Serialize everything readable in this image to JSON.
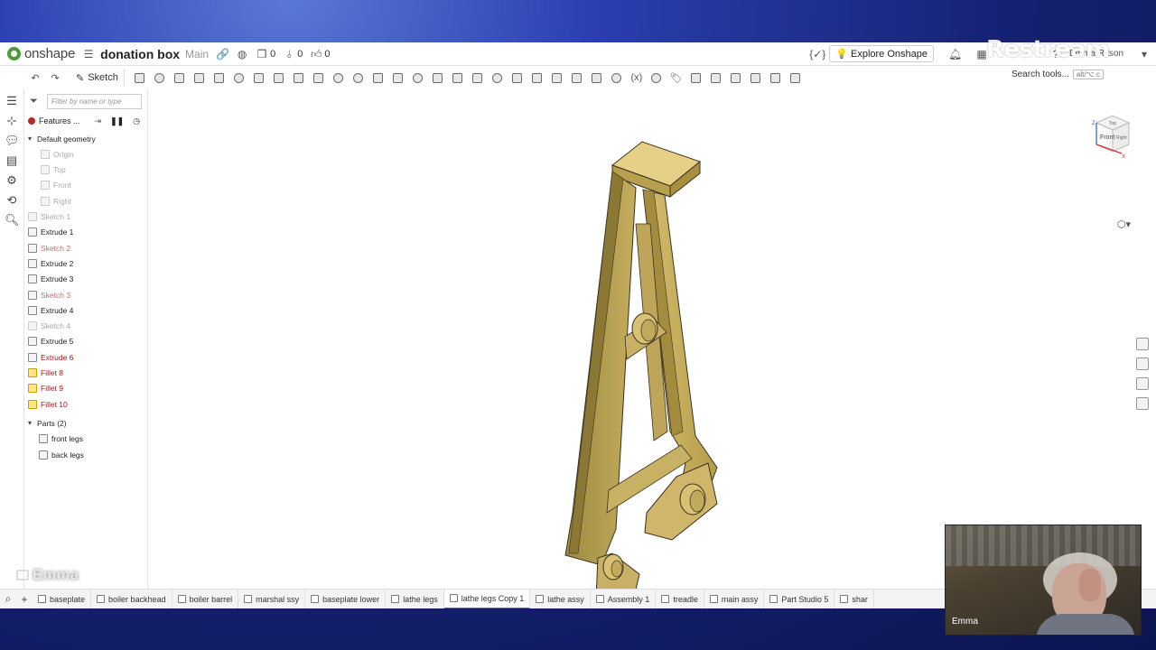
{
  "app": {
    "logo": "onshape",
    "doc_title": "donation box",
    "branch": "Main"
  },
  "topbar": {
    "counts": [
      "0",
      "0",
      "0"
    ],
    "explore_label": "Explore Onshape",
    "user": "Emma Ritson"
  },
  "toolbar": {
    "sketch_label": "Sketch",
    "search_label": "Search tools...",
    "search_shortcut": "alt/⌥ c"
  },
  "panel": {
    "filter_placeholder": "Filter by name or type",
    "features_label": "Features ...",
    "default_geometry_label": "Default geometry",
    "geometry": [
      {
        "label": "Origin"
      },
      {
        "label": "Top"
      },
      {
        "label": "Front"
      },
      {
        "label": "Right"
      }
    ],
    "features": [
      {
        "label": "Sketch 1",
        "state": "faded"
      },
      {
        "label": "Extrude 1",
        "state": "normal"
      },
      {
        "label": "Sketch 2",
        "state": "sketch"
      },
      {
        "label": "Extrude 2",
        "state": "normal"
      },
      {
        "label": "Extrude 3",
        "state": "normal"
      },
      {
        "label": "Sketch 3",
        "state": "sketch"
      },
      {
        "label": "Extrude 4",
        "state": "normal"
      },
      {
        "label": "Sketch 4",
        "state": "faded"
      },
      {
        "label": "Extrude 5",
        "state": "normal"
      },
      {
        "label": "Extrude 6",
        "state": "warn"
      },
      {
        "label": "Fillet 8",
        "state": "warn"
      },
      {
        "label": "Fillet 9",
        "state": "warn"
      },
      {
        "label": "Fillet 10",
        "state": "warn"
      }
    ],
    "parts_label": "Parts (2)",
    "parts": [
      {
        "label": "front legs"
      },
      {
        "label": "back legs"
      }
    ]
  },
  "viewcube": {
    "top": "Top",
    "front": "Front",
    "right": "Right",
    "axes": [
      "Z",
      "X"
    ]
  },
  "tabs": [
    {
      "label": "baseplate"
    },
    {
      "label": "boiler backhead"
    },
    {
      "label": "boiler barrel"
    },
    {
      "label": "marshal ssy"
    },
    {
      "label": "baseplate lower"
    },
    {
      "label": "lathe legs"
    },
    {
      "label": "lathe legs Copy 1",
      "active": true
    },
    {
      "label": "lathe assy"
    },
    {
      "label": "Assembly 1"
    },
    {
      "label": "treadle"
    },
    {
      "label": "main assy"
    },
    {
      "label": "Part Studio 5"
    },
    {
      "label": "shar"
    }
  ],
  "overlay": {
    "restream": "Restream",
    "watermark_name": "Emma",
    "webcam_name": "Emma"
  },
  "colors": {
    "part": "#c9b15e",
    "accent": "#2a7ad5",
    "error": "#a01a1a"
  }
}
